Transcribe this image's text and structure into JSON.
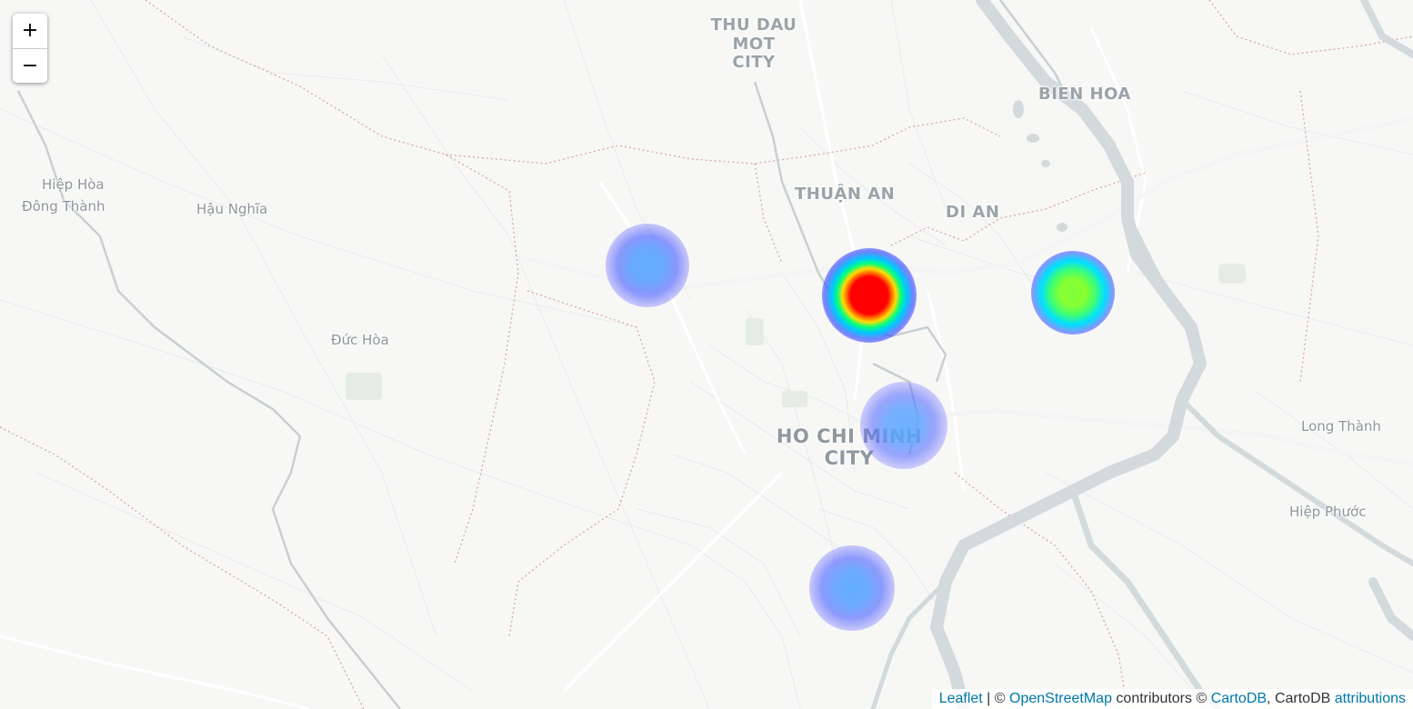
{
  "map": {
    "zoom_controls": {
      "zoom_in_label": "+",
      "zoom_out_label": "−"
    },
    "places": [
      {
        "name": "THU DAU MOT\nCITY",
        "kind": "city"
      },
      {
        "name": "BIEN HOA",
        "kind": "city"
      },
      {
        "name": "THUẬN AN",
        "kind": "city"
      },
      {
        "name": "DI AN",
        "kind": "city"
      },
      {
        "name": "HO CHI MINH\nCITY",
        "kind": "major"
      },
      {
        "name": "Hiệp Hòa",
        "kind": "town"
      },
      {
        "name": "Đông Thành",
        "kind": "town"
      },
      {
        "name": "Hậu Nghĩa",
        "kind": "town"
      },
      {
        "name": "Đức Hòa",
        "kind": "town"
      },
      {
        "name": "Long Thành",
        "kind": "town"
      },
      {
        "name": "Hiệp Phước",
        "kind": "town"
      }
    ],
    "heatmap": {
      "gradient": [
        "#0000ff",
        "#00ffff",
        "#00ff00",
        "#ffff00",
        "#ff0000"
      ],
      "points": [
        {
          "intensity": 1.0
        },
        {
          "intensity": 0.55
        },
        {
          "intensity": 0.22
        },
        {
          "intensity": 0.18
        },
        {
          "intensity": 0.18
        }
      ]
    },
    "colors": {
      "water": "#d4dadc",
      "road": "#ffffff",
      "boundary": "#d9a7a7",
      "land": "#f7f7f6"
    }
  },
  "attribution": {
    "leaflet": "Leaflet",
    "sep": " | © ",
    "osm": "OpenStreetMap",
    "contributors": " contributors © ",
    "cartodb": "CartoDB",
    "cartodb2": ", CartoDB ",
    "attributions": "attributions"
  }
}
